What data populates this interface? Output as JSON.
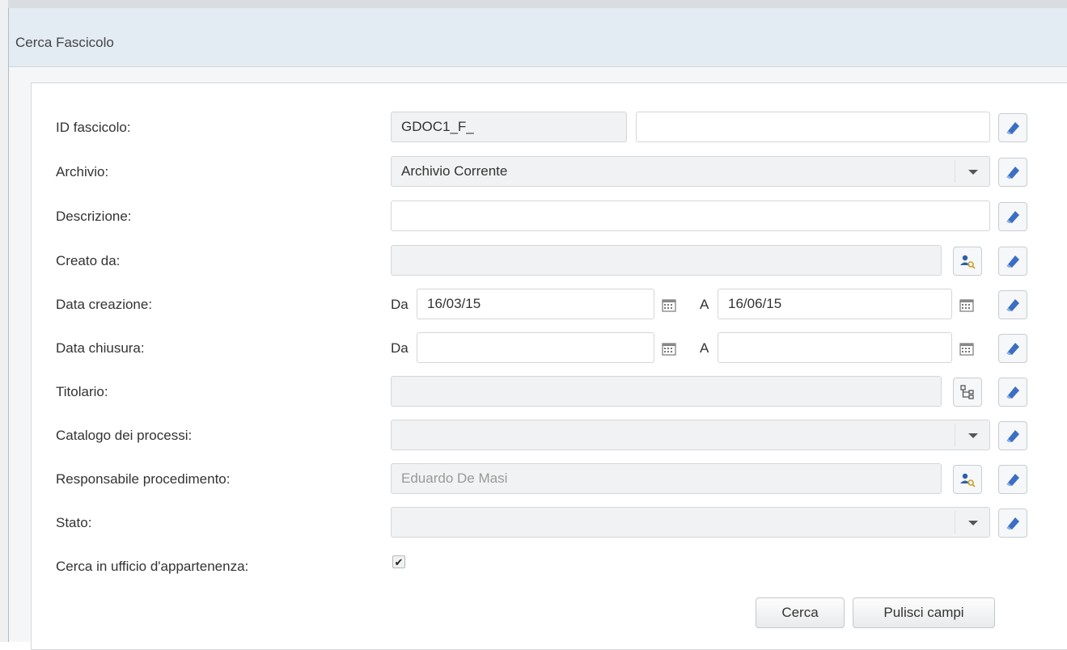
{
  "dialog": {
    "title": "Cerca Fascicolo"
  },
  "form": {
    "id_fascicolo": {
      "label": "ID fascicolo:",
      "prefix_value": "GDOC1_F_",
      "value": ""
    },
    "archivio": {
      "label": "Archivio:",
      "value": "Archivio Corrente"
    },
    "descrizione": {
      "label": "Descrizione:",
      "value": ""
    },
    "creato_da": {
      "label": "Creato da:",
      "value": ""
    },
    "data_creazione": {
      "label": "Data creazione:",
      "from_label": "Da",
      "from_value": "16/03/15",
      "to_label": "A",
      "to_value": "16/06/15"
    },
    "data_chiusura": {
      "label": "Data chiusura:",
      "from_label": "Da",
      "from_value": "",
      "to_label": "A",
      "to_value": ""
    },
    "titolario": {
      "label": "Titolario:",
      "value": ""
    },
    "catalogo": {
      "label": "Catalogo dei processi:",
      "value": ""
    },
    "responsabile": {
      "label": "Responsabile procedimento:",
      "value": "Eduardo De Masi"
    },
    "stato": {
      "label": "Stato:",
      "value": ""
    },
    "cerca_ufficio": {
      "label": "Cerca in ufficio d'appartenenza:",
      "checked": true
    }
  },
  "buttons": {
    "search": "Cerca",
    "clear": "Pulisci campi"
  },
  "icons": {
    "clear": "eraser-icon",
    "user_lookup": "user-search-icon",
    "calendar": "calendar-icon",
    "tree": "tree-icon",
    "dropdown": "chevron-down-icon"
  },
  "colors": {
    "eraser": "#3a6fc4",
    "title_bar": "#e3ebf3"
  }
}
